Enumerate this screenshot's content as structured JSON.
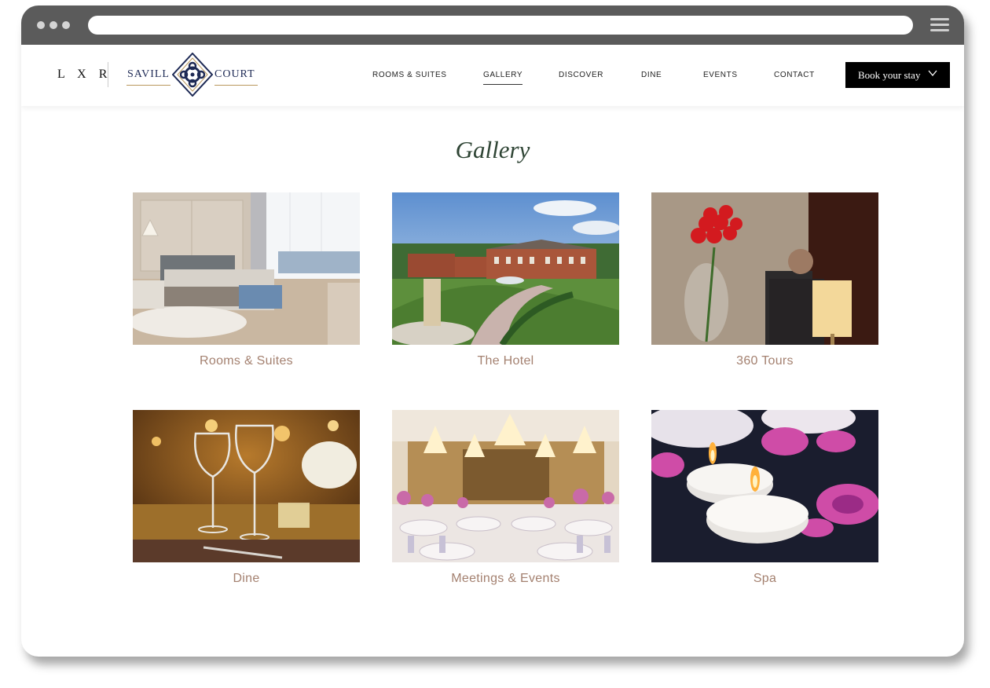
{
  "site": {
    "lxr_logo": "L X R",
    "brand_left": "SAVILL",
    "brand_right": "COURT"
  },
  "nav": {
    "items": [
      "ROOMS & SUITES",
      "GALLERY",
      "DISCOVER",
      "DINE",
      "EVENTS",
      "CONTACT"
    ],
    "active": "GALLERY",
    "book_label": "Book your stay"
  },
  "page": {
    "title": "Gallery"
  },
  "gallery": {
    "cards": [
      {
        "caption": "Rooms & Suites",
        "scene": "bedroom"
      },
      {
        "caption": "The Hotel",
        "scene": "hotel-exterior"
      },
      {
        "caption": "360 Tours",
        "scene": "roses-lobby"
      },
      {
        "caption": "Dine",
        "scene": "wine-glasses"
      },
      {
        "caption": "Meetings & Events",
        "scene": "ballroom"
      },
      {
        "caption": "Spa",
        "scene": "candles-orchids"
      }
    ]
  },
  "colors": {
    "title": "#2f4535",
    "caption": "#a48170",
    "brand_navy": "#1e2a55",
    "brand_gold": "#b9975b",
    "chrome": "#5b5b5b"
  }
}
